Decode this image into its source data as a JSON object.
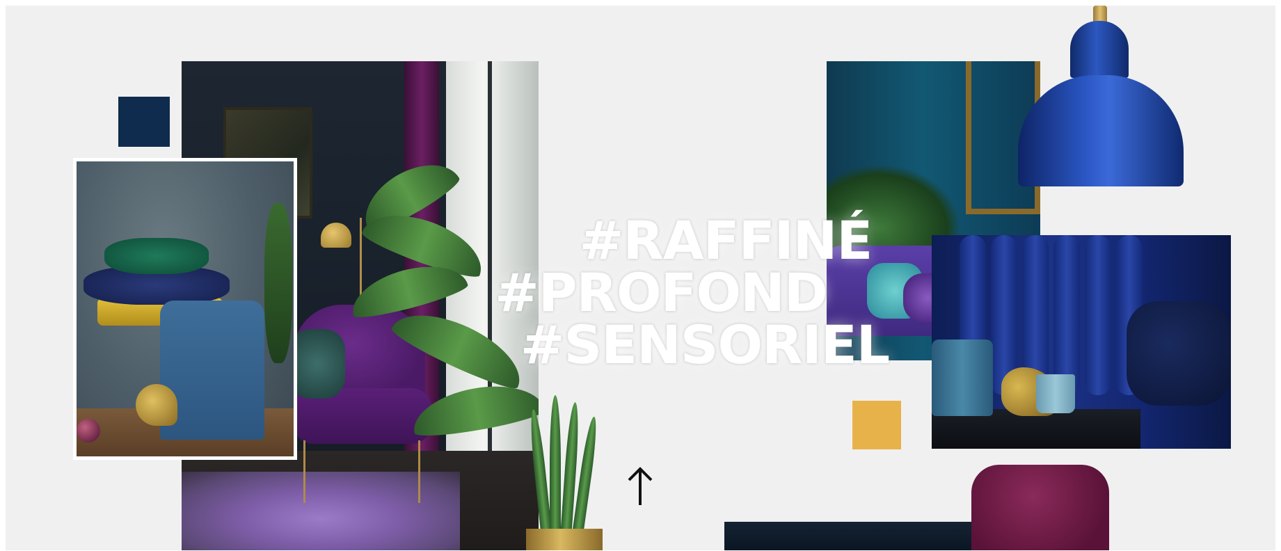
{
  "headline": {
    "line_1": "#RAFFINÉ",
    "line_2": "#PROFOND",
    "line_3": "#SENSORIEL"
  },
  "colors": {
    "background": "#f0f0f0",
    "navy_square": "#0f2b4d",
    "yellow_square": "#e8b24a",
    "text": "#ffffff"
  },
  "icons": {
    "arrow": "arrow-up-icon"
  }
}
